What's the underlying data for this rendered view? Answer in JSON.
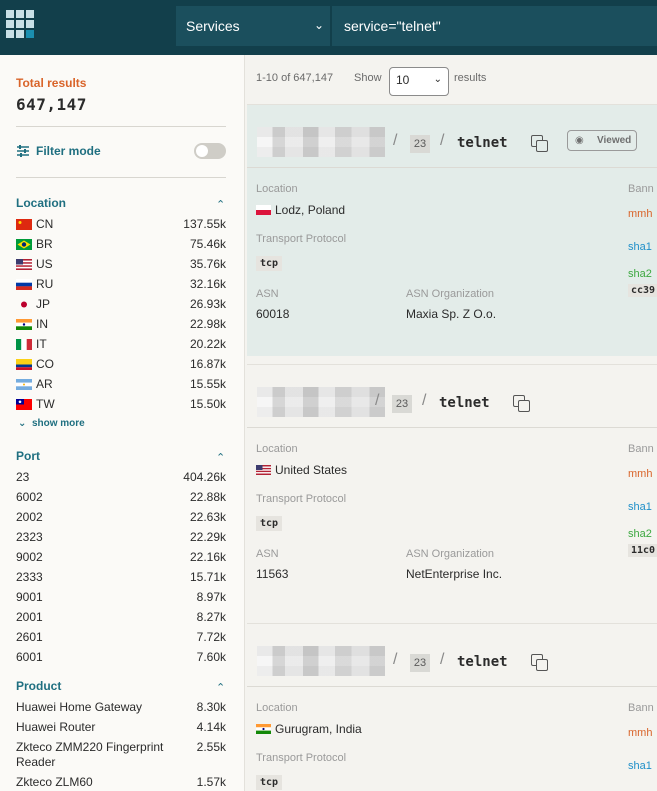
{
  "header": {
    "scope": "Services",
    "query": "service=\"telnet\""
  },
  "sidebar": {
    "total_label": "Total results",
    "total_value": "647,147",
    "filter_mode_label": "Filter mode",
    "show_more": "show more",
    "location": {
      "title": "Location",
      "items": [
        {
          "name": "CN",
          "count": "137.55k",
          "flag": "cn"
        },
        {
          "name": "BR",
          "count": "75.46k",
          "flag": "br"
        },
        {
          "name": "US",
          "count": "35.76k",
          "flag": "us"
        },
        {
          "name": "RU",
          "count": "32.16k",
          "flag": "ru"
        },
        {
          "name": "JP",
          "count": "26.93k",
          "flag": "jp"
        },
        {
          "name": "IN",
          "count": "22.98k",
          "flag": "in"
        },
        {
          "name": "IT",
          "count": "20.22k",
          "flag": "it"
        },
        {
          "name": "CO",
          "count": "16.87k",
          "flag": "co"
        },
        {
          "name": "AR",
          "count": "15.55k",
          "flag": "ar"
        },
        {
          "name": "TW",
          "count": "15.50k",
          "flag": "tw"
        }
      ]
    },
    "port": {
      "title": "Port",
      "items": [
        {
          "name": "23",
          "count": "404.26k"
        },
        {
          "name": "6002",
          "count": "22.88k"
        },
        {
          "name": "2002",
          "count": "22.63k"
        },
        {
          "name": "2323",
          "count": "22.29k"
        },
        {
          "name": "9002",
          "count": "22.16k"
        },
        {
          "name": "2333",
          "count": "15.71k"
        },
        {
          "name": "9001",
          "count": "8.97k"
        },
        {
          "name": "2001",
          "count": "8.27k"
        },
        {
          "name": "2601",
          "count": "7.72k"
        },
        {
          "name": "6001",
          "count": "7.60k"
        }
      ]
    },
    "product": {
      "title": "Product",
      "items": [
        {
          "name": "Huawei Home Gateway",
          "count": "8.30k"
        },
        {
          "name": "Huawei Router",
          "count": "4.14k"
        },
        {
          "name": "Zkteco ZMM220 Fingerprint Reader",
          "count": "2.55k"
        },
        {
          "name": "Zkteco ZLM60",
          "count": "1.57k"
        }
      ]
    }
  },
  "results": {
    "range": "1-10 of 647,147",
    "show_label": "Show",
    "per_page": "10",
    "results_label": "results",
    "viewed_label": "Viewed",
    "labels": {
      "location": "Location",
      "transport": "Transport Protocol",
      "asn": "ASN",
      "asn_org": "ASN Organization",
      "banner": "Bann"
    },
    "cards": [
      {
        "port": "23",
        "service": "telnet",
        "location": "Lodz, Poland",
        "transport": "tcp",
        "asn": "60018",
        "asn_org": "Maxia Sp. Z O.o.",
        "banner_text": "mmh",
        "sha1_label": "sha1",
        "sha256_label": "sha2",
        "hash_prefix": "cc39"
      },
      {
        "port": "23",
        "service": "telnet",
        "location": "United States",
        "transport": "tcp",
        "asn": "11563",
        "asn_org": "NetEnterprise Inc.",
        "banner_text": "mmh",
        "sha1_label": "sha1",
        "sha256_label": "sha2",
        "hash_prefix": "11c0"
      },
      {
        "port": "23",
        "service": "telnet",
        "location": "Gurugram, India",
        "transport": "tcp",
        "banner_text": "mmh",
        "sha1_label": "sha1"
      }
    ]
  },
  "colors": {
    "header_bg": "#123f4b",
    "accent_teal": "#1f6f80",
    "accent_orange": "#d9642a",
    "active_card_bg": "#e3ece9"
  }
}
